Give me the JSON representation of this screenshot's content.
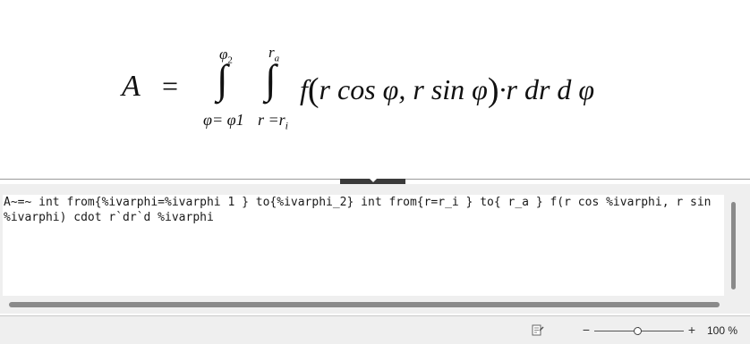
{
  "formula_preview": {
    "lhs": "A",
    "equals": "=",
    "integral_sign": "∫",
    "outer_upper_limit": "φ",
    "outer_upper_sub": "2",
    "outer_lower_limit": "φ= φ1",
    "inner_upper_limit": "r",
    "inner_upper_sub": "a",
    "inner_lower_limit": "r =r",
    "inner_lower_sub": "i",
    "integrand_f": "f",
    "open_paren": "(",
    "integrand_args": "r cos φ, r sin φ",
    "close_paren": ")",
    "integrand_tail": "·r  dr  d φ"
  },
  "command_editor": {
    "text": "A~=~ int from{%ivarphi=%ivarphi 1 } to{%ivarphi_2} int from{r=r_i } to{ r_a } f(r cos %ivarphi, r sin %ivarphi) cdot r`dr`d %ivarphi"
  },
  "statusbar": {
    "zoom_out_label": "−",
    "zoom_in_label": "+",
    "zoom_level": "100 %",
    "zoom_slider_fraction": 0.5
  }
}
